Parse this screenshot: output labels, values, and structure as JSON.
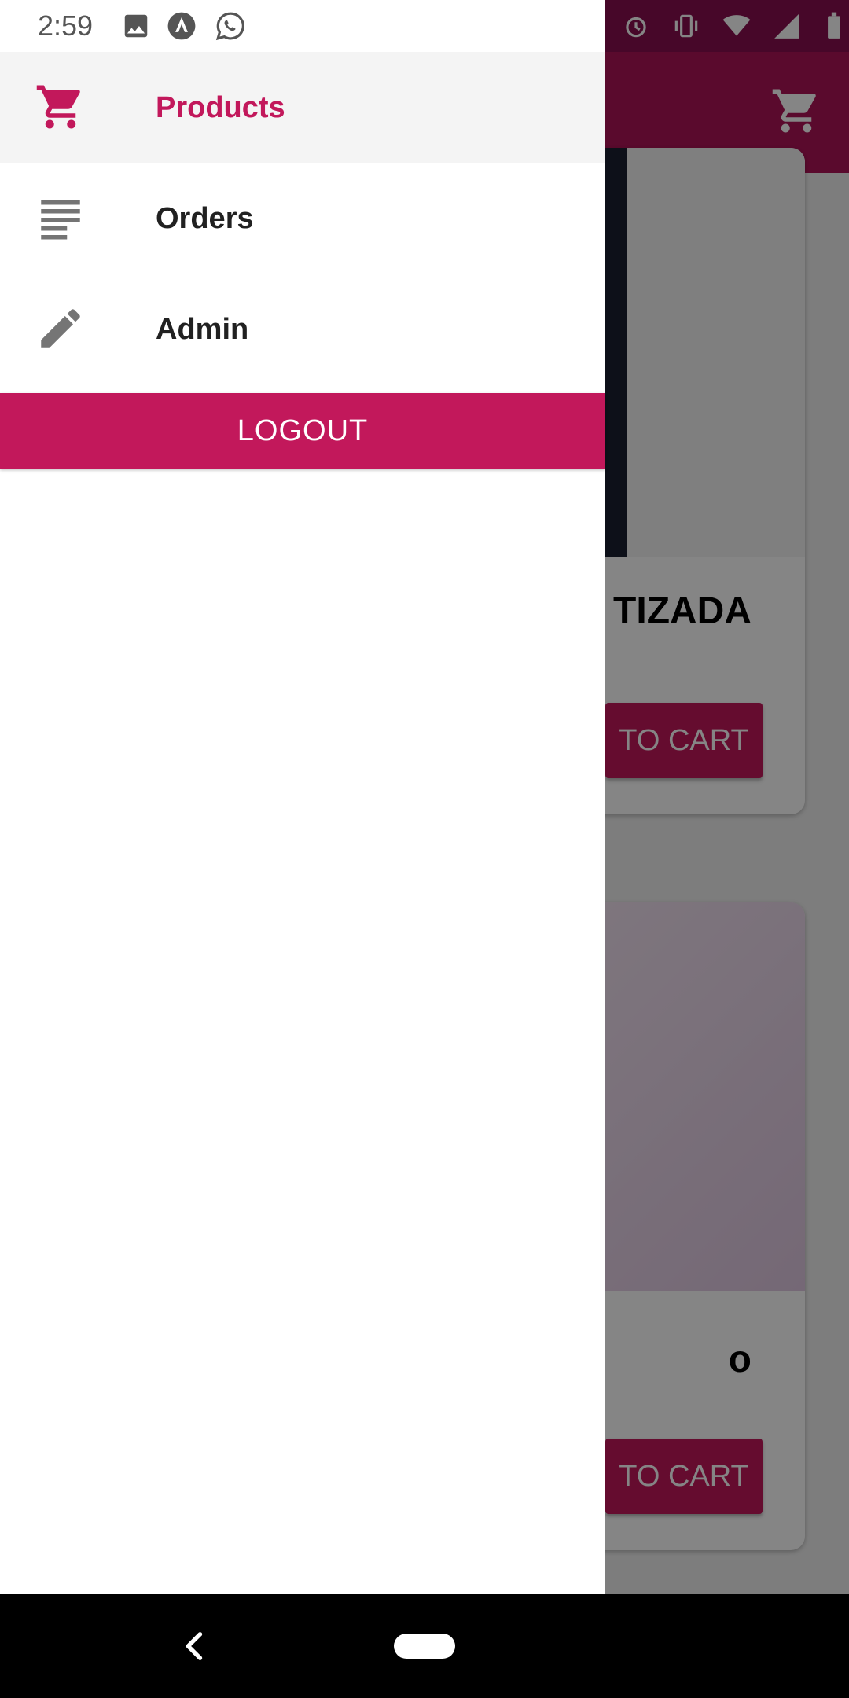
{
  "status_bar": {
    "time": "2:59",
    "notification_icons": [
      "image-icon",
      "app-icon",
      "whatsapp-icon"
    ],
    "system_icons": [
      "alarm-icon",
      "vibrate-icon",
      "wifi-icon",
      "signal-icon",
      "battery-icon"
    ]
  },
  "drawer": {
    "items": [
      {
        "label": "Products",
        "icon": "cart-icon",
        "active": true
      },
      {
        "label": "Orders",
        "icon": "list-icon",
        "active": false
      },
      {
        "label": "Admin",
        "icon": "pencil-icon",
        "active": false
      }
    ],
    "logout_label": "LOGOUT"
  },
  "background_app": {
    "toolbar_icon": "cart-icon",
    "cards": [
      {
        "title_visible": "TIZADA",
        "button_visible": "TO CART"
      },
      {
        "title_visible": "o",
        "button_visible": "TO CART"
      }
    ]
  },
  "colors": {
    "accent": "#c2185b",
    "toolbar": "#ad1457",
    "active_item_bg": "#f4f4f4"
  },
  "system_nav": {
    "back_icon": "back-chevron-icon",
    "home_icon": "home-pill-icon"
  }
}
